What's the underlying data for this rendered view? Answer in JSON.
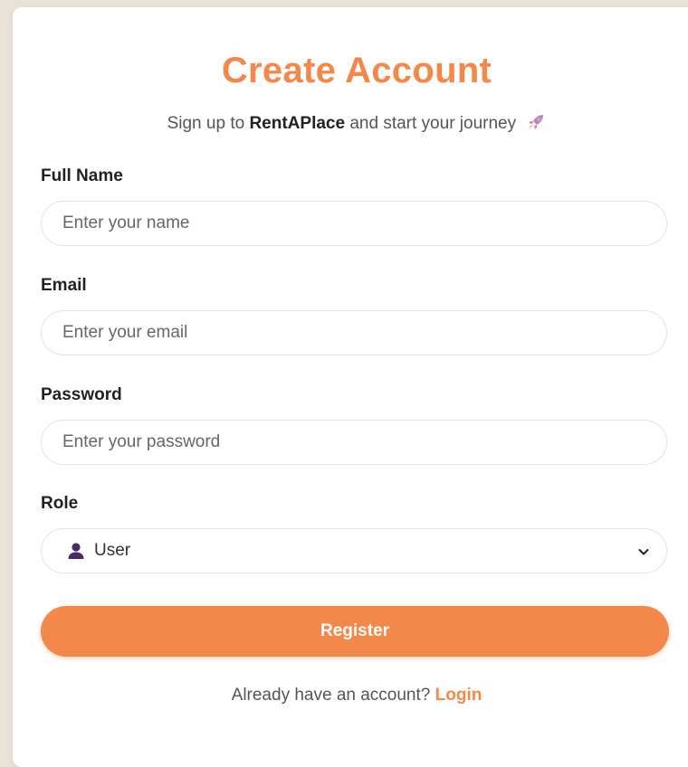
{
  "header": {
    "title": "Create Account",
    "subtitle_prefix": "Sign up to",
    "brand": "RentAPlace",
    "subtitle_suffix": "and start your journey",
    "subtitle_icon": "rocket-icon"
  },
  "form": {
    "full_name": {
      "label": "Full Name",
      "value": "",
      "placeholder": "Enter your name"
    },
    "email": {
      "label": "Email",
      "value": "",
      "placeholder": "Enter your email"
    },
    "password": {
      "label": "Password",
      "value": "",
      "placeholder": "Enter your password"
    },
    "role": {
      "label": "Role",
      "selected": "User",
      "icon": "user-icon"
    },
    "register_label": "Register"
  },
  "footer": {
    "prompt": "Already have an account?",
    "login_label": "Login"
  },
  "colors": {
    "accent": "#f4884a",
    "page_background": "#e8e3d9",
    "card_background": "#ffffff",
    "user_icon": "#4a2a6a"
  }
}
